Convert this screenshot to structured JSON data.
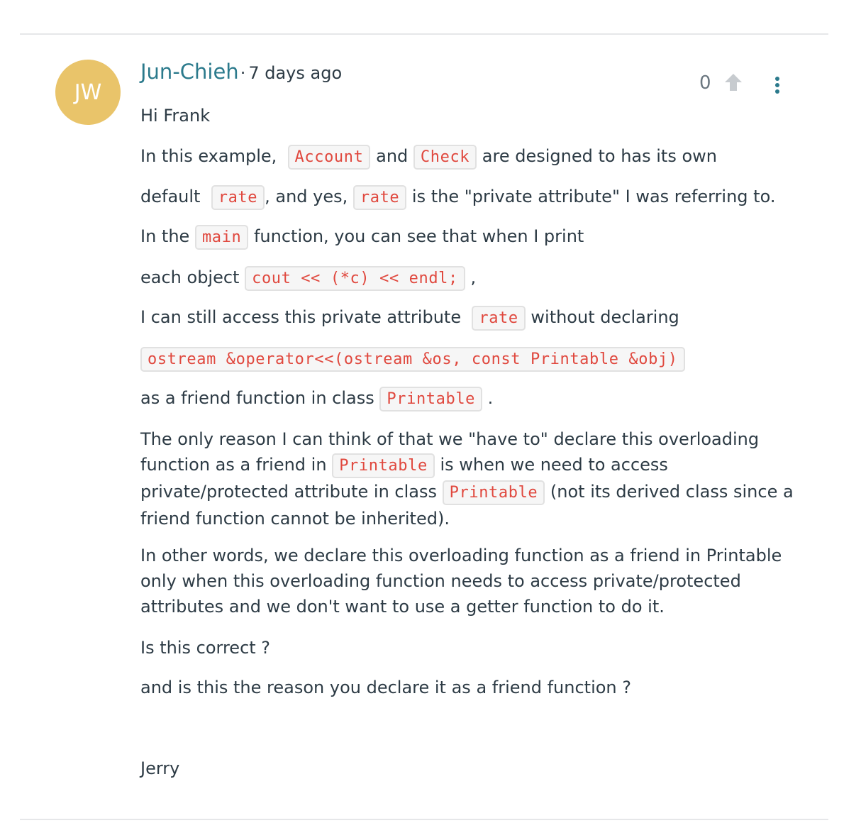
{
  "comment": {
    "avatar_initials": "JW",
    "author": "Jun-Chieh",
    "separator": "·",
    "time": "7 days ago",
    "vote_count": "0",
    "colors": {
      "avatar": "#e9c46a",
      "author": "#2b7a8c",
      "code": "#e0483e"
    },
    "icons": {
      "upvote": "arrow-up-icon",
      "menu": "kebab-menu-icon"
    },
    "body": {
      "greeting": "Hi Frank",
      "l1_a": "In this example,",
      "l1_code1": "Account",
      "l1_b": "and",
      "l1_code2": "Check",
      "l1_c": "are designed to has its own",
      "l2_a": "default",
      "l2_code1": "rate",
      "l2_b": ", and yes,",
      "l2_code2": "rate",
      "l2_c": "is the \"private attribute\" I was referring to.",
      "l3_a": "In the",
      "l3_code": "main",
      "l3_b": "function, you can see that when I print",
      "l4_a": "each object",
      "l4_code": "cout << (*c) << endl;",
      "l4_b": ",",
      "l5_a": "I can still access this private attribute",
      "l5_code": "rate",
      "l5_b": "without declaring",
      "l6_code": "ostream &operator<<(ostream &os, const Printable &obj)",
      "l7_a": "as a friend function in class",
      "l7_code": "Printable",
      "l7_b": ".",
      "p1_a": "The only reason I can think of that we \"have to\" declare this overloading function as a friend in",
      "p1_code1": "Printable",
      "p1_b": "is when we need to access private/protected attribute in class",
      "p1_code2": "Printable",
      "p1_c": "(not its derived class since a friend function cannot be inherited).",
      "p2": "In other words, we declare this overloading function as a friend in Printable only when this overloading function needs to access private/protected attributes and we don't want to use a getter function to do it.",
      "q1": "Is this correct ?",
      "q2": "and is this the reason you declare it as a friend function ?",
      "signature": "Jerry"
    }
  }
}
